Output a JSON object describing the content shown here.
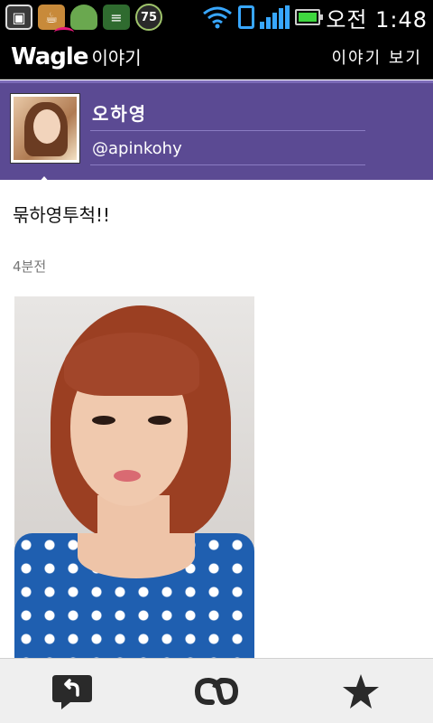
{
  "status_bar": {
    "badge_number": "75",
    "time": "오전 1:48",
    "icons": [
      "shopping-bag-icon",
      "coffee-icon",
      "android-icon",
      "list-icon",
      "paw-badge-icon",
      "wifi-icon",
      "phone-icon",
      "signal-icon",
      "battery-icon"
    ]
  },
  "header": {
    "brand": "Wagle",
    "brand_sub": "이야기",
    "view_story": "이야기 보기"
  },
  "profile": {
    "name": "오하영",
    "handle": "@apinkohy"
  },
  "post": {
    "text": "묶하영투척!!",
    "time_ago": "4분전"
  },
  "toolbar": {
    "icons": [
      "reply-icon",
      "retweet-icon",
      "star-icon"
    ]
  },
  "colors": {
    "profile_bg": "#5b4a93",
    "header_bg": "#000000",
    "toolbar_bg": "#efefef"
  }
}
